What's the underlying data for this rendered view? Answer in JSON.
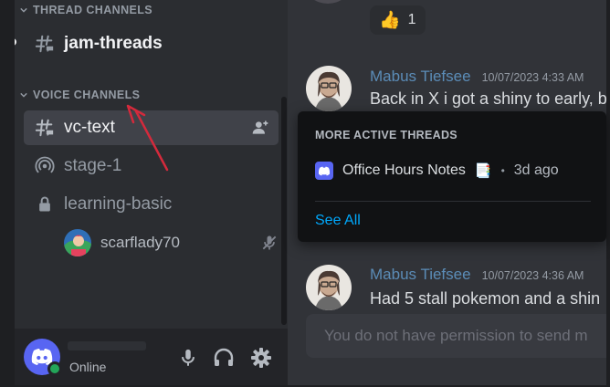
{
  "sidebar": {
    "thread_category": "THREAD CHANNELS",
    "voice_category": "VOICE CHANNELS",
    "channels": {
      "jam_threads": "jam-threads",
      "vc_text": "vc-text",
      "stage": "stage-1",
      "learning": "learning-basic"
    },
    "voice_user": "scarflady70"
  },
  "user_panel": {
    "status": "Online"
  },
  "chat": {
    "reaction": {
      "emoji": "👍",
      "count": "1"
    },
    "messages": [
      {
        "author": "Mabus Tiefsee",
        "time": "10/07/2023 4:33 AM",
        "text": "Back in X i got a shiny to early, b"
      },
      {
        "author": "Mabus Tiefsee",
        "time": "10/07/2023 4:36 AM",
        "text": "Had 5 stall pokemon and a shin"
      }
    ],
    "composer_placeholder": "You do not have permission to send m"
  },
  "popup": {
    "title": "MORE ACTIVE THREADS",
    "thread_name": "Office Hours Notes",
    "thread_emoji": "📑",
    "separator": "•",
    "thread_age": "3d ago",
    "see_all": "See All"
  },
  "colors": {
    "accent": "#5865f2",
    "link": "#00a8fc",
    "online": "#23a559",
    "annotation_arrow": "#d42a3c"
  }
}
